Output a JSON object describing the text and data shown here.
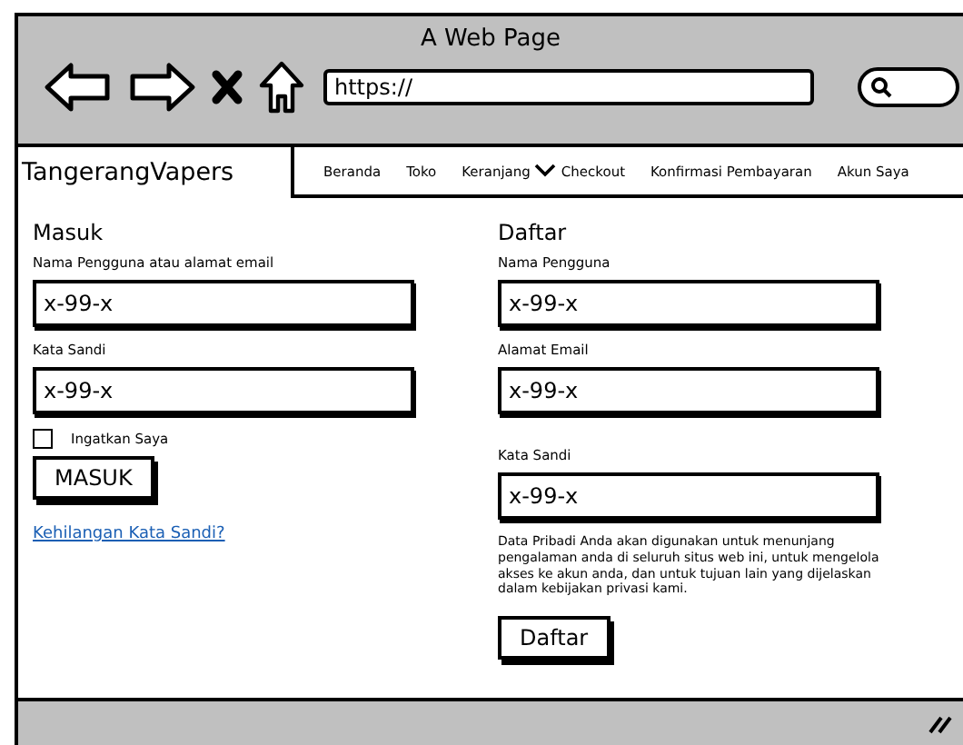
{
  "window": {
    "title": "A Web Page"
  },
  "address_bar": {
    "value": "https://"
  },
  "brand": "TangerangVapers",
  "nav": [
    {
      "label": "Beranda",
      "dropdown": false
    },
    {
      "label": "Toko",
      "dropdown": false
    },
    {
      "label": "Keranjang",
      "dropdown": true
    },
    {
      "label": "Checkout",
      "dropdown": false
    },
    {
      "label": "Konfirmasi Pembayaran",
      "dropdown": false
    },
    {
      "label": "Akun Saya",
      "dropdown": false
    }
  ],
  "login": {
    "title": "Masuk",
    "fields": [
      {
        "label": "Nama Pengguna atau alamat email",
        "value": "x-99-x"
      },
      {
        "label": "Kata Sandi",
        "value": "x-99-x"
      }
    ],
    "remember": {
      "label": "Ingatkan Saya",
      "checked": false
    },
    "button": "MASUK",
    "lost_password": "Kehilangan Kata Sandi?"
  },
  "register": {
    "title": "Daftar",
    "fields": [
      {
        "label": "Nama Pengguna",
        "value": "x-99-x"
      },
      {
        "label": "Alamat Email",
        "value": "x-99-x"
      },
      {
        "label": "Kata Sandi",
        "value": "x-99-x"
      }
    ],
    "privacy": "Data Pribadi Anda akan digunakan untuk menunjang pengalaman anda di seluruh situs web ini, untuk mengelola akses ke akun anda, dan untuk tujuan lain yang dijelaskan dalam kebijakan privasi kami.",
    "button": "Daftar"
  }
}
